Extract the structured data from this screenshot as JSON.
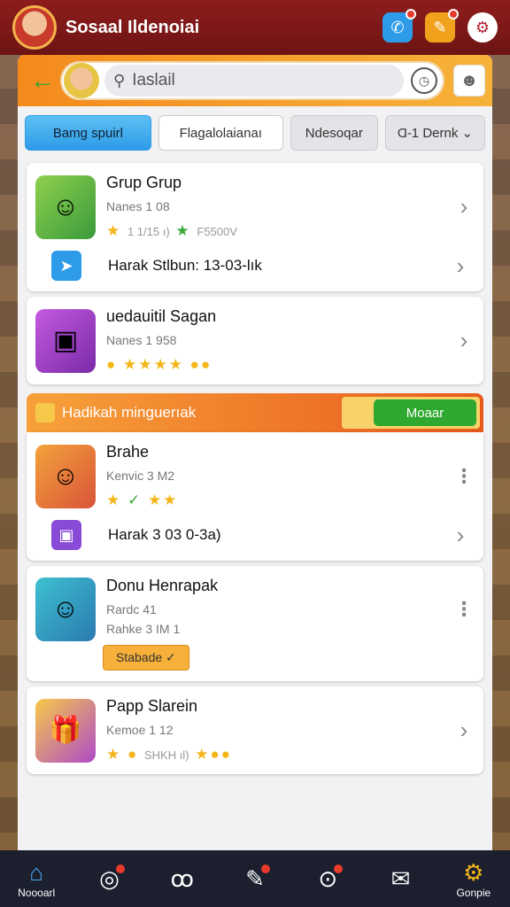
{
  "topbar": {
    "title": "Sosaal Ildenoiai"
  },
  "search": {
    "value": "Iaslail"
  },
  "tabs": [
    {
      "label": "Bamg spuirl"
    },
    {
      "label": "Flagalolaianaı"
    },
    {
      "label": "Ndesoqar"
    },
    {
      "label": "Ɑ-1 Dernk ⌄"
    }
  ],
  "cards": [
    {
      "name": "Grup Grup",
      "meta": "Nanes 1 08",
      "stars_text": "1 1/15 ı)",
      "stars_text2": "F5500V",
      "sub_label": "Harak Stlbun: 13-03-lık"
    },
    {
      "name": "uedauitil Sagan",
      "meta": "Nanes 1 958"
    }
  ],
  "banner": {
    "label": "Hadikah minguerıak",
    "button": "Moaar"
  },
  "cards2": [
    {
      "name": "Brahe",
      "meta": "Kenvic 3 M2",
      "sub_label": "Harak 3 03 0-3a)"
    },
    {
      "name": "Donu Henrapak",
      "meta": "Rardc 41",
      "meta2": "Rahke 3 IM    1",
      "badge": "Stabade ✓"
    },
    {
      "name": "Papp Slarein",
      "meta": "Kemoe 1 12",
      "stars_text": "SHKH ıl)"
    }
  ],
  "bottomnav": {
    "home": "Noooarl",
    "settings": "Gonpie"
  },
  "colors": {
    "topbar": "#8e1c1c",
    "accent_orange": "#f48a1c",
    "tab_active": "#2e9be8",
    "button_green": "#2ea82e",
    "nav_bg": "#1b1f2e"
  }
}
